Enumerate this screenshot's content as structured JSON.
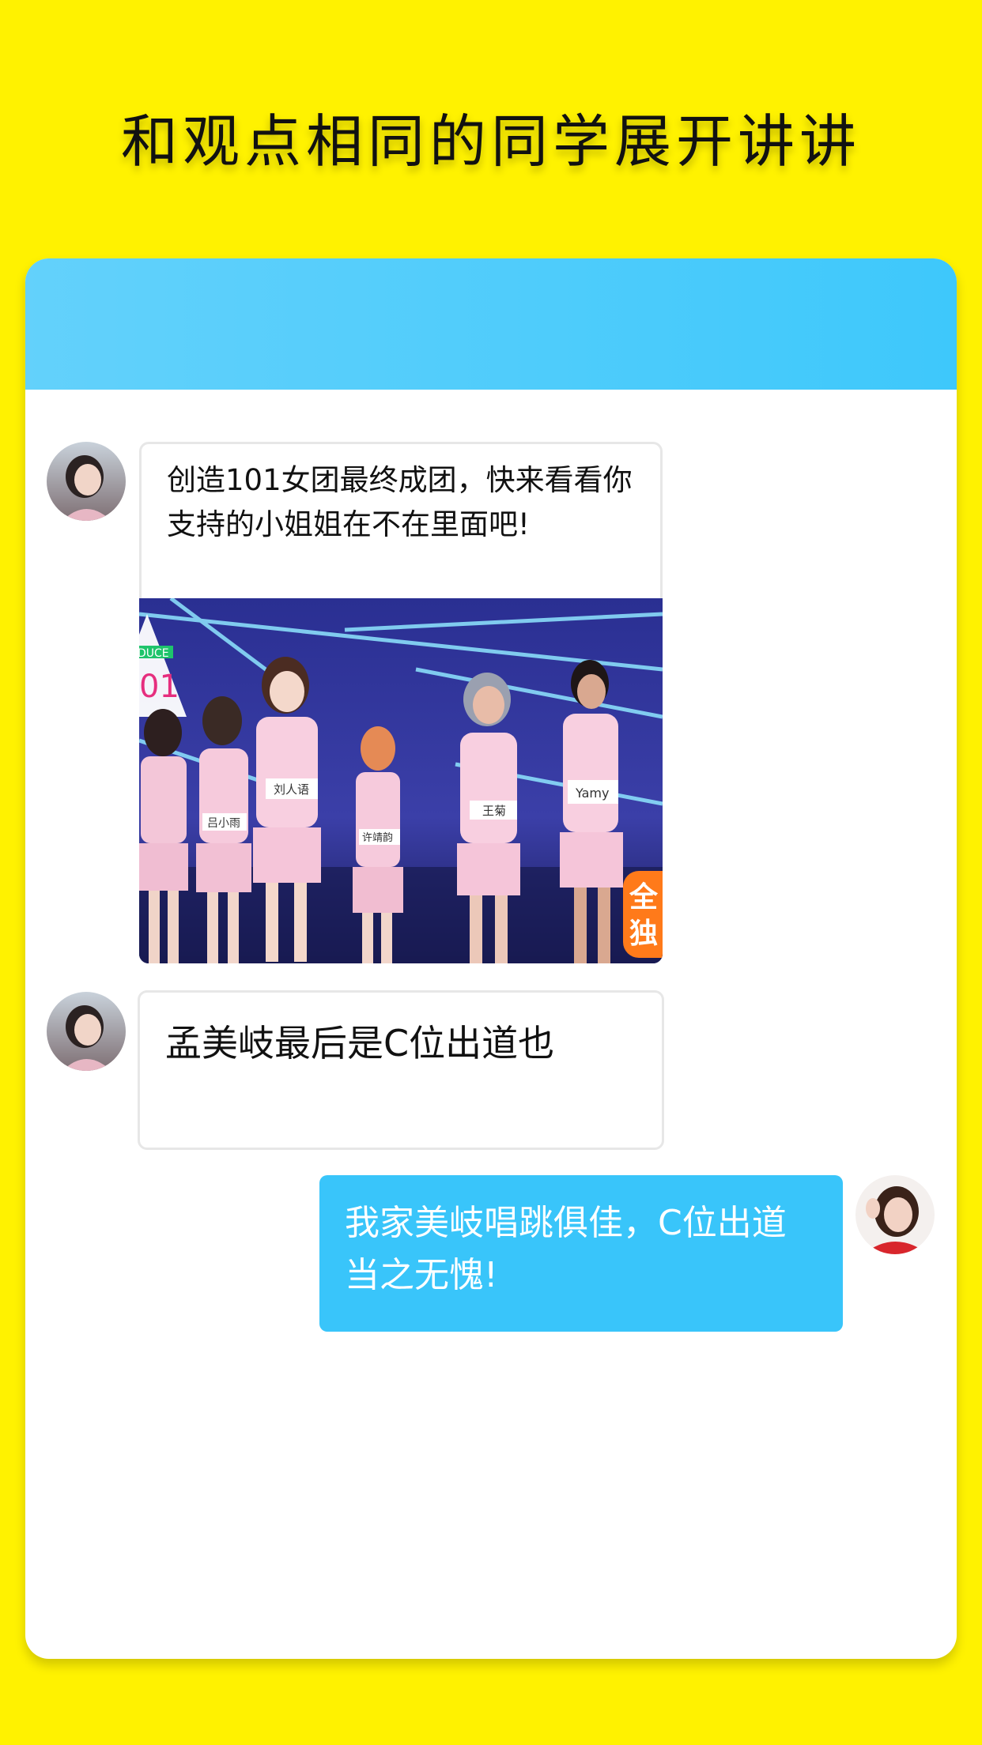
{
  "title": "和观点相同的同学展开讲讲",
  "messages": [
    {
      "side": "left",
      "text": "创造101女团最终成团，快来看看你支持的小姐姐在不在里面吧!",
      "image": {
        "badges": [
          "DUCE",
          "01"
        ],
        "name_tags": [
          "刘人语",
          "吕小雨",
          "许靖韵",
          "王菊",
          "Yamy"
        ],
        "corner_label": [
          "全",
          "独"
        ]
      }
    },
    {
      "side": "left",
      "text": "孟美岐最后是C位出道也"
    },
    {
      "side": "right",
      "text": "我家美岐唱跳俱佳，C位出道当之无愧!"
    }
  ],
  "colors": {
    "background": "#fff200",
    "header": "#3ec8fb",
    "right_bubble": "#39c5fa"
  }
}
